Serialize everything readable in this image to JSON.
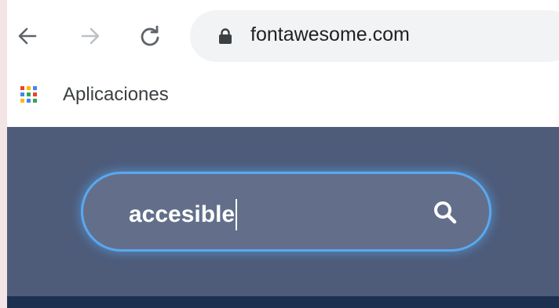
{
  "browser": {
    "nav": {
      "back_icon": "arrow-left-icon",
      "forward_icon": "arrow-right-icon",
      "reload_icon": "reload-icon"
    },
    "address_bar": {
      "lock_icon": "lock-icon",
      "url": "fontawesome.com"
    },
    "bookmarks": {
      "apps_icon": "apps-grid-icon",
      "apps_label": "Aplicaciones"
    }
  },
  "page": {
    "search": {
      "value": "accesible",
      "icon": "search-icon",
      "focus_color": "#5aa8f0"
    },
    "colors": {
      "hero_background": "#4e5c7a",
      "input_background": "#636f8a",
      "footer_band": "#1e3050"
    }
  }
}
